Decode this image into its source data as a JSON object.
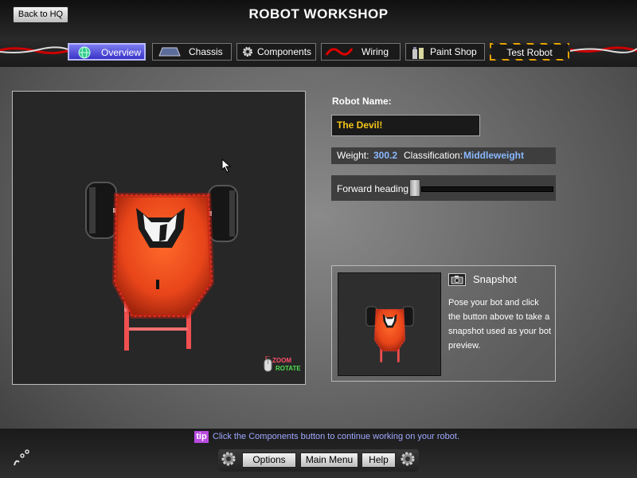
{
  "header": {
    "back_label": "Back to HQ",
    "title": "ROBOT WORKSHOP"
  },
  "tabs": [
    {
      "label": "Overview",
      "icon": "globe-icon",
      "active": true
    },
    {
      "label": "Chassis",
      "icon": "chassis-icon"
    },
    {
      "label": "Components",
      "icon": "gear-icon"
    },
    {
      "label": "Wiring",
      "icon": "wire-icon"
    },
    {
      "label": "Paint Shop",
      "icon": "paint-icon"
    },
    {
      "label": "Test Robot",
      "icon": ""
    }
  ],
  "viewport": {
    "zoom_label": "ZOOM",
    "rotate_label": "ROTATE"
  },
  "robot": {
    "name_label": "Robot Name:",
    "name": "The Devil!",
    "weight_label": "Weight:",
    "weight": "300.2",
    "class_label": "Classification:",
    "classification": "Middleweight",
    "heading_label": "Forward heading:",
    "heading_value": 0.0
  },
  "snapshot": {
    "title": "Snapshot",
    "description": "Pose your bot and click the button above to take a snapshot used as your bot preview."
  },
  "footer": {
    "tip_badge": "tip",
    "tip_text": "Click the Components button to continue working on your robot.",
    "options_label": "Options",
    "main_menu_label": "Main Menu",
    "help_label": "Help"
  },
  "colors": {
    "name": "#f5c518",
    "stat_value": "#8ab8ff",
    "active_tab": "#4b46d8",
    "tip": "#b84ae0",
    "robot_body": "#e8451a"
  }
}
